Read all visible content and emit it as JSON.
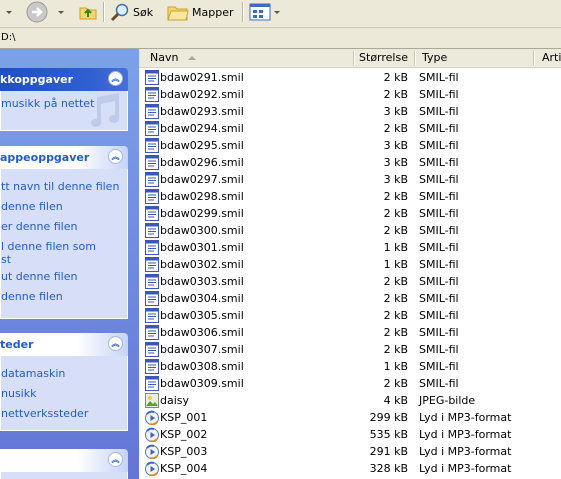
{
  "toolbar": {
    "search_label": "Søk",
    "folders_label": "Mapper"
  },
  "address": {
    "path": "D:\\"
  },
  "taskpane": {
    "panels": [
      {
        "title": "kkoppgaver",
        "links": [
          "musikk på nettet"
        ]
      },
      {
        "title": "appeoppgaver",
        "links": [
          "tt navn til denne filen",
          "denne filen",
          "er denne filen",
          "l denne filen som",
          "st",
          "ut denne filen",
          "denne filen"
        ]
      },
      {
        "title": "teder",
        "links": [
          "datamaskin",
          "nusikk",
          "nettverkssteder"
        ]
      }
    ]
  },
  "columns": {
    "name": "Navn",
    "size": "Størrelse",
    "type": "Type",
    "artist": "Artis"
  },
  "files": [
    {
      "name": "bdaw0291.smil",
      "size": "2 kB",
      "type": "SMIL-fil",
      "icon": "smil-file-icon"
    },
    {
      "name": "bdaw0292.smil",
      "size": "2 kB",
      "type": "SMIL-fil",
      "icon": "smil-file-icon"
    },
    {
      "name": "bdaw0293.smil",
      "size": "3 kB",
      "type": "SMIL-fil",
      "icon": "smil-file-icon"
    },
    {
      "name": "bdaw0294.smil",
      "size": "2 kB",
      "type": "SMIL-fil",
      "icon": "smil-file-icon"
    },
    {
      "name": "bdaw0295.smil",
      "size": "3 kB",
      "type": "SMIL-fil",
      "icon": "smil-file-icon"
    },
    {
      "name": "bdaw0296.smil",
      "size": "3 kB",
      "type": "SMIL-fil",
      "icon": "smil-file-icon"
    },
    {
      "name": "bdaw0297.smil",
      "size": "3 kB",
      "type": "SMIL-fil",
      "icon": "smil-file-icon"
    },
    {
      "name": "bdaw0298.smil",
      "size": "2 kB",
      "type": "SMIL-fil",
      "icon": "smil-file-icon"
    },
    {
      "name": "bdaw0299.smil",
      "size": "2 kB",
      "type": "SMIL-fil",
      "icon": "smil-file-icon"
    },
    {
      "name": "bdaw0300.smil",
      "size": "2 kB",
      "type": "SMIL-fil",
      "icon": "smil-file-icon"
    },
    {
      "name": "bdaw0301.smil",
      "size": "1 kB",
      "type": "SMIL-fil",
      "icon": "smil-file-icon"
    },
    {
      "name": "bdaw0302.smil",
      "size": "1 kB",
      "type": "SMIL-fil",
      "icon": "smil-file-icon"
    },
    {
      "name": "bdaw0303.smil",
      "size": "2 kB",
      "type": "SMIL-fil",
      "icon": "smil-file-icon"
    },
    {
      "name": "bdaw0304.smil",
      "size": "2 kB",
      "type": "SMIL-fil",
      "icon": "smil-file-icon"
    },
    {
      "name": "bdaw0305.smil",
      "size": "2 kB",
      "type": "SMIL-fil",
      "icon": "smil-file-icon"
    },
    {
      "name": "bdaw0306.smil",
      "size": "2 kB",
      "type": "SMIL-fil",
      "icon": "smil-file-icon"
    },
    {
      "name": "bdaw0307.smil",
      "size": "2 kB",
      "type": "SMIL-fil",
      "icon": "smil-file-icon"
    },
    {
      "name": "bdaw0308.smil",
      "size": "1 kB",
      "type": "SMIL-fil",
      "icon": "smil-file-icon"
    },
    {
      "name": "bdaw0309.smil",
      "size": "2 kB",
      "type": "SMIL-fil",
      "icon": "smil-file-icon"
    },
    {
      "name": "daisy",
      "size": "4 kB",
      "type": "JPEG-bilde",
      "icon": "jpeg-file-icon"
    },
    {
      "name": "KSP_001",
      "size": "299 kB",
      "type": "Lyd i MP3-format",
      "icon": "mp3-file-icon"
    },
    {
      "name": "KSP_002",
      "size": "535 kB",
      "type": "Lyd i MP3-format",
      "icon": "mp3-file-icon"
    },
    {
      "name": "KSP_003",
      "size": "291 kB",
      "type": "Lyd i MP3-format",
      "icon": "mp3-file-icon"
    },
    {
      "name": "KSP_004",
      "size": "328 kB",
      "type": "Lyd i MP3-format",
      "icon": "mp3-file-icon"
    }
  ]
}
